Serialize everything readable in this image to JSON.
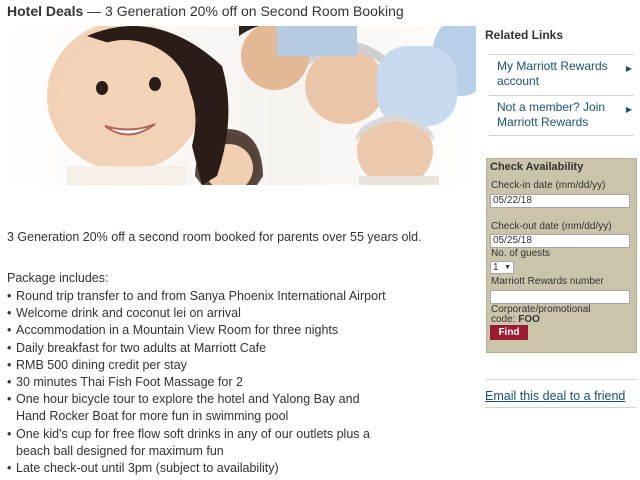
{
  "header": {
    "label": "Hotel Deals",
    "separator": " — ",
    "title": "3 Generation 20% off on Second Room Booking"
  },
  "main": {
    "description": "3 Generation 20% off a second room booked for parents over 55 years old.",
    "package_heading": "Package includes:",
    "package_items": [
      "Round trip transfer to and from Sanya Phoenix International Airport",
      "Welcome drink and coconut lei on arrival",
      "Accommodation in a Mountain View Room for three nights",
      "Daily breakfast for two adults at Marriott Cafe",
      "RMB 500 dining credit per stay",
      "30 minutes Thai Fish Foot Massage for 2",
      "One hour bicycle tour to explore the hotel and Yalong Bay and Hand Rocker Boat for more fun in swimming pool",
      "One kid's cup for free flow soft drinks in any of our outlets plus a beach ball designed for maximum fun",
      "Late check-out until 3pm (subject to availability)"
    ]
  },
  "sidebar": {
    "related_title": "Related Links",
    "links": [
      {
        "label": "My Marriott Rewards account",
        "icon": "chevron-right-icon"
      },
      {
        "label": "Not a member? Join Marriott Rewards",
        "icon": "chevron-right-icon"
      }
    ],
    "check_availability": {
      "title": "Check Availability",
      "checkin_label": "Check-in date (mm/dd/yy)",
      "checkin_value": "05/22/18",
      "checkout_label": "Check-out date (mm/dd/yy)",
      "checkout_value": "05/25/18",
      "guests_label": "No. of guests",
      "guests_value": "1",
      "rewards_label": "Marriott Rewards number",
      "rewards_value": "",
      "corporate_label": "Corporate/promotional",
      "code_label": "code:",
      "code_value": "FOO",
      "find_label": "Find"
    },
    "email_link": "Email this deal to a friend"
  },
  "colors": {
    "link": "#1a5276",
    "find_button": "#9b1b2f",
    "availability_bg": "#c9c4aa"
  }
}
